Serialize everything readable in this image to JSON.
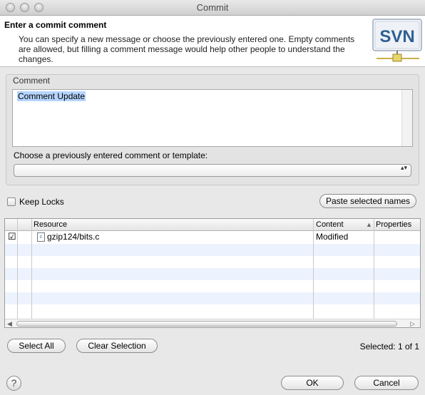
{
  "window": {
    "title": "Commit"
  },
  "header": {
    "title": "Enter a commit comment",
    "description": "You can specify a new message or choose the previously entered one. Empty comments are allowed, but filling a comment message would help other people to understand the changes.",
    "logo_text": "SVN"
  },
  "comment": {
    "group_label": "Comment",
    "value": "Comment Update",
    "choose_label": "Choose a previously entered comment or template:",
    "selected_template": ""
  },
  "options": {
    "keep_locks_label": "Keep Locks",
    "keep_locks_checked": false,
    "paste_button": "Paste selected names"
  },
  "table": {
    "columns": [
      "Resource",
      "Content",
      "Properties"
    ],
    "sort_column": "Content",
    "rows": [
      {
        "checked": true,
        "check_glyph": "☑",
        "file_icon_glyph": "c",
        "resource": "gzip124/bits.c",
        "content": "Modified",
        "properties": ""
      }
    ]
  },
  "buttons": {
    "select_all": "Select All",
    "clear_selection": "Clear Selection",
    "ok": "OK",
    "cancel": "Cancel"
  },
  "status": {
    "selected": "Selected: 1 of 1"
  },
  "icons": {
    "help": "?",
    "sort_arrow": "▲",
    "select_arrows": "▴▾",
    "scroll_left": "◀",
    "scroll_right": "▷"
  }
}
